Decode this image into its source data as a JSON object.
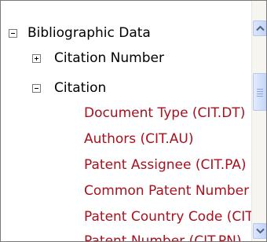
{
  "tree": {
    "root": {
      "label": "Bibliographic Data",
      "state": "expanded",
      "children": [
        {
          "label": "Citation Number",
          "state": "collapsed"
        },
        {
          "label": "Citation",
          "state": "expanded",
          "fields": [
            "Document Type (CIT.DT)",
            "Authors (CIT.AU)",
            "Patent Assignee (CIT.PA)",
            "Common Patent Number",
            "Patent Country Code (CIT.PC)",
            "Patent Number (CIT.PN)"
          ]
        }
      ]
    }
  },
  "scrollbar": {
    "up_icon": "chevron-up-icon",
    "down_icon": "chevron-down-icon"
  },
  "colors": {
    "field_text": "#a8101e",
    "node_text": "#000000",
    "scrollbar_accent": "#c1d3f7"
  }
}
